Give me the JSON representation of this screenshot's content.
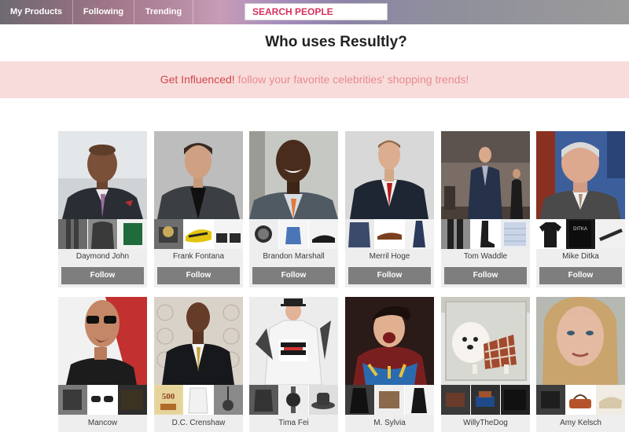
{
  "nav": {
    "tabs": [
      {
        "label": "My Products"
      },
      {
        "label": "Following"
      },
      {
        "label": "Trending"
      }
    ],
    "search_placeholder": "SEARCH PEOPLE"
  },
  "page_title": "Who uses Resultly?",
  "banner": {
    "strong": "Get Influenced!",
    "rest": "follow your favorite celebrities' shopping trends!"
  },
  "follow_label": "Follow",
  "people_row1": [
    {
      "name": "Daymond John"
    },
    {
      "name": "Frank Fontana"
    },
    {
      "name": "Brandon Marshall"
    },
    {
      "name": "Merril Hoge"
    },
    {
      "name": "Tom Waddle"
    },
    {
      "name": "Mike Ditka"
    }
  ],
  "people_row2": [
    {
      "name": "Mancow"
    },
    {
      "name": "D.C. Crenshaw"
    },
    {
      "name": "Tima Fei"
    },
    {
      "name": "M. Sylvia"
    },
    {
      "name": "WillyTheDog"
    },
    {
      "name": "Amy Kelsch"
    }
  ],
  "thumb_texts": {
    "ditka_shirt": "DITKA",
    "crenshaw_sign": "500"
  },
  "colors": {
    "accent_pink": "#d6335b",
    "banner_bg": "#f8dcdc",
    "banner_strong": "#d34646",
    "banner_rest": "#ea8a8a",
    "follow_button": "#7e7e7e"
  }
}
